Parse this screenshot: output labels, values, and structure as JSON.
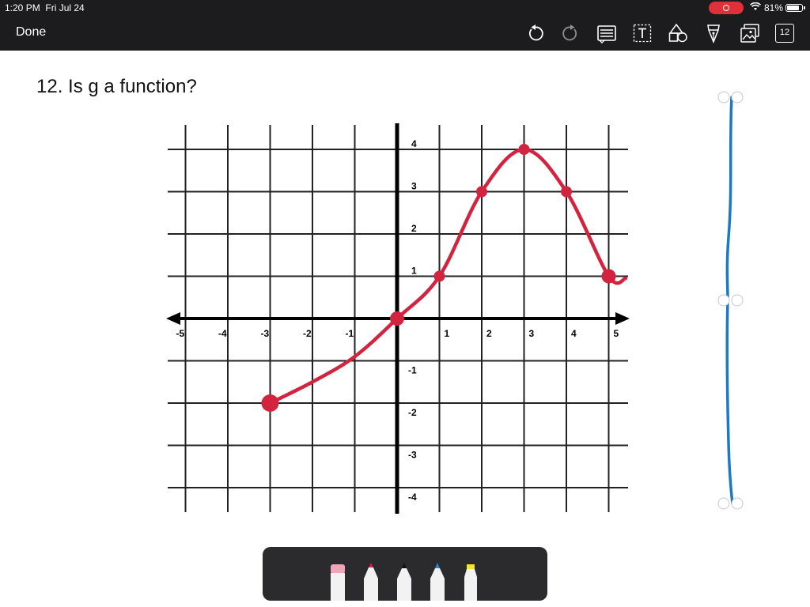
{
  "status": {
    "time": "1:20 PM",
    "date": "Fri Jul 24",
    "battery": "81%",
    "battery_level": 0.81
  },
  "toolbar": {
    "done_label": "Done",
    "tools": [
      "undo-icon",
      "redo-icon",
      "notes-icon",
      "text-box-icon",
      "shapes-icon",
      "pen-nib-icon",
      "image-icon"
    ],
    "page_count": "12"
  },
  "note": {
    "question": "12. Is g a function?"
  },
  "chart_data": {
    "type": "line",
    "title": "",
    "xlabel": "",
    "ylabel": "",
    "xlim": [
      -5,
      5
    ],
    "ylim": [
      -4,
      4
    ],
    "x_ticks": [
      "-5",
      "-4",
      "-3",
      "-2",
      "-1",
      "1",
      "2",
      "3",
      "4",
      "5"
    ],
    "y_ticks": [
      "4",
      "3",
      "2",
      "1",
      "-1",
      "-2",
      "-3",
      "-4"
    ],
    "grid": true,
    "series": [
      {
        "color": "#d2233f",
        "x": [
          -3,
          -2,
          -1,
          0,
          1,
          2,
          3,
          4,
          5
        ],
        "y": [
          -2,
          -1.5,
          -0.9,
          0,
          1,
          3,
          4,
          3,
          1
        ]
      }
    ],
    "points": [
      {
        "x": -3,
        "y": -2
      },
      {
        "x": 0,
        "y": 0
      },
      {
        "x": 1,
        "y": 1
      },
      {
        "x": 2,
        "y": 3
      },
      {
        "x": 3,
        "y": 4
      },
      {
        "x": 4,
        "y": 3
      },
      {
        "x": 5,
        "y": 1
      }
    ]
  },
  "pens": [
    {
      "name": "eraser",
      "color": "#f1a5b8"
    },
    {
      "name": "red-marker",
      "color": "#d2233f"
    },
    {
      "name": "black-pen",
      "color": "#111111"
    },
    {
      "name": "blue-pen",
      "color": "#2b86d9"
    },
    {
      "name": "yellow-highlighter",
      "color": "#f5e52a"
    }
  ],
  "scrubber": {
    "color": "#1a7ac7"
  }
}
